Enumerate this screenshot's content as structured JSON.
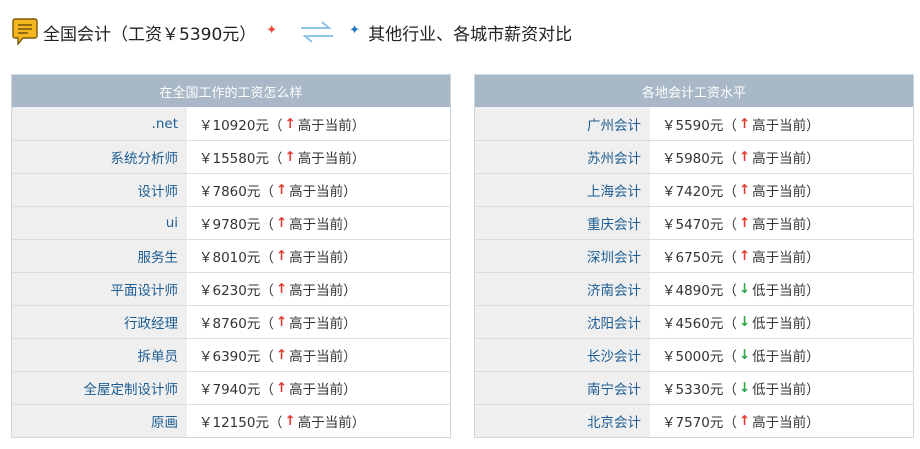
{
  "header": {
    "title": "全国会计（工资￥5390元）",
    "compare_label": "其他行业、各城市薪资对比",
    "star_symbol": "✦"
  },
  "left_table": {
    "title": "在全国工作的工资怎么样",
    "rows": [
      {
        "name": ".net",
        "salary": "￥10920元",
        "open": "（",
        "arrow": "↑",
        "direction": "up",
        "note": "高于当前",
        "close": "）"
      },
      {
        "name": "系统分析师",
        "salary": "￥15580元",
        "open": "（",
        "arrow": "↑",
        "direction": "up",
        "note": "高于当前",
        "close": "）"
      },
      {
        "name": "设计师",
        "salary": "￥7860元",
        "open": "（",
        "arrow": "↑",
        "direction": "up",
        "note": "高于当前",
        "close": "）"
      },
      {
        "name": "ui",
        "salary": "￥9780元",
        "open": "（",
        "arrow": "↑",
        "direction": "up",
        "note": "高于当前",
        "close": "）"
      },
      {
        "name": "服务生",
        "salary": "￥8010元",
        "open": "（",
        "arrow": "↑",
        "direction": "up",
        "note": "高于当前",
        "close": "）"
      },
      {
        "name": "平面设计师",
        "salary": "￥6230元",
        "open": "（",
        "arrow": "↑",
        "direction": "up",
        "note": "高于当前",
        "close": "）"
      },
      {
        "name": "行政经理",
        "salary": "￥8760元",
        "open": "（",
        "arrow": "↑",
        "direction": "up",
        "note": "高于当前",
        "close": "）"
      },
      {
        "name": "拆单员",
        "salary": "￥6390元",
        "open": "（",
        "arrow": "↑",
        "direction": "up",
        "note": "高于当前",
        "close": "）"
      },
      {
        "name": "全屋定制设计师",
        "salary": "￥7940元",
        "open": "（",
        "arrow": "↑",
        "direction": "up",
        "note": "高于当前",
        "close": "）"
      },
      {
        "name": "原画",
        "salary": "￥12150元",
        "open": "（",
        "arrow": "↑",
        "direction": "up",
        "note": "高于当前",
        "close": "）"
      }
    ]
  },
  "right_table": {
    "title": "各地会计工资水平",
    "rows": [
      {
        "name": "广州会计",
        "salary": "￥5590元",
        "open": "（",
        "arrow": "↑",
        "direction": "up",
        "note": "高于当前",
        "close": "）"
      },
      {
        "name": "苏州会计",
        "salary": "￥5980元",
        "open": "（",
        "arrow": "↑",
        "direction": "up",
        "note": "高于当前",
        "close": "）"
      },
      {
        "name": "上海会计",
        "salary": "￥7420元",
        "open": "（",
        "arrow": "↑",
        "direction": "up",
        "note": "高于当前",
        "close": "）"
      },
      {
        "name": "重庆会计",
        "salary": "￥5470元",
        "open": "（",
        "arrow": "↑",
        "direction": "up",
        "note": "高于当前",
        "close": "）"
      },
      {
        "name": "深圳会计",
        "salary": "￥6750元",
        "open": "（",
        "arrow": "↑",
        "direction": "up",
        "note": "高于当前",
        "close": "）"
      },
      {
        "name": "济南会计",
        "salary": "￥4890元",
        "open": "（",
        "arrow": "↓",
        "direction": "down",
        "note": "低于当前",
        "close": "）"
      },
      {
        "name": "沈阳会计",
        "salary": "￥4560元",
        "open": "（",
        "arrow": "↓",
        "direction": "down",
        "note": "低于当前",
        "close": "）"
      },
      {
        "name": "长沙会计",
        "salary": "￥5000元",
        "open": "（",
        "arrow": "↓",
        "direction": "down",
        "note": "低于当前",
        "close": "）"
      },
      {
        "name": "南宁会计",
        "salary": "￥5330元",
        "open": "（",
        "arrow": "↓",
        "direction": "down",
        "note": "低于当前",
        "close": "）"
      },
      {
        "name": "北京会计",
        "salary": "￥7570元",
        "open": "（",
        "arrow": "↑",
        "direction": "up",
        "note": "高于当前",
        "close": "）"
      }
    ]
  },
  "colors": {
    "header_bg": "#a8b8c6",
    "link": "#1d5d93",
    "up": "#e03a2e",
    "down": "#2aa74a",
    "name_cell_bg": "#efefef"
  },
  "icons": {
    "chat": "chat-bubble-icon",
    "swap": "swap-arrows-icon",
    "star_red": "red-sparkle-icon",
    "star_blue": "blue-sparkle-icon"
  }
}
